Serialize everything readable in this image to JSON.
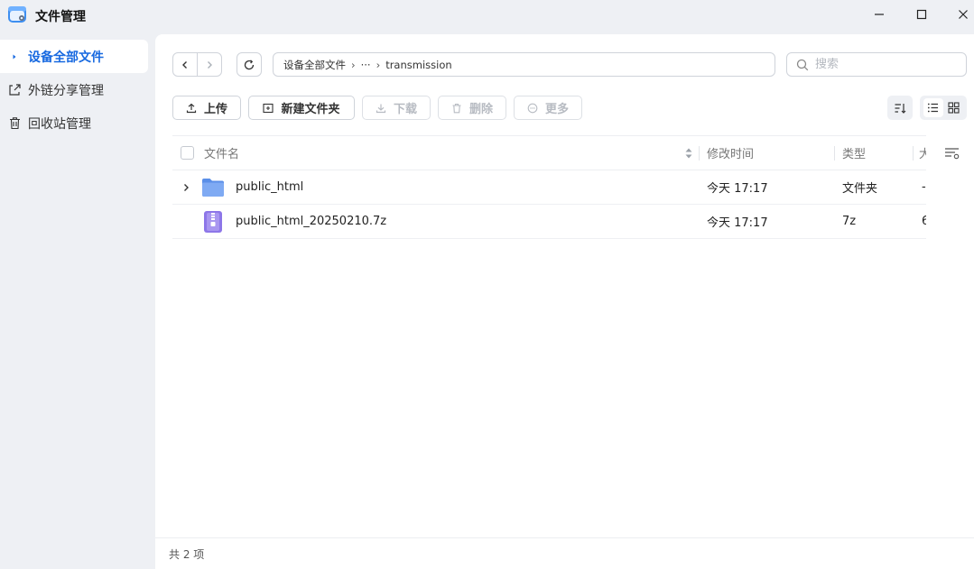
{
  "window": {
    "title": "文件管理"
  },
  "sidebar": {
    "items": [
      {
        "label": "设备全部文件",
        "icon": "caret-right-icon"
      },
      {
        "label": "外链分享管理",
        "icon": "share-link-icon"
      },
      {
        "label": "回收站管理",
        "icon": "trash-icon"
      }
    ]
  },
  "path": {
    "root": "设备全部文件",
    "ellipsis": "···",
    "current": "transmission"
  },
  "search": {
    "placeholder": "搜索"
  },
  "toolbar": {
    "upload": "上传",
    "new_folder": "新建文件夹",
    "download": "下载",
    "delete": "删除",
    "more": "更多"
  },
  "table": {
    "headers": {
      "name": "文件名",
      "mtime": "修改时间",
      "type": "类型",
      "size": "大"
    },
    "rows": [
      {
        "name": "public_html",
        "mtime": "今天 17:17",
        "type": "文件夹",
        "size": "-",
        "icon": "folder-icon"
      },
      {
        "name": "public_html_20250210.7z",
        "mtime": "今天 17:17",
        "type": "7z",
        "size": "6",
        "icon": "archive-icon"
      }
    ]
  },
  "footer": {
    "count": "共 2 项"
  },
  "colors": {
    "accent": "#1769e0",
    "folder": "#6ea2f5",
    "archive": "#8d76e8"
  }
}
